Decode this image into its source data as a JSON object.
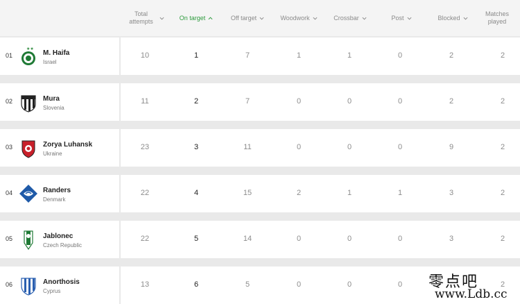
{
  "table": {
    "columns": [
      {
        "label": "Total attempts",
        "sort": "down",
        "active": false
      },
      {
        "label": "On target",
        "sort": "up",
        "active": true
      },
      {
        "label": "Off target",
        "sort": "down",
        "active": false
      },
      {
        "label": "Woodwork",
        "sort": "down",
        "active": false
      },
      {
        "label": "Crossbar",
        "sort": "down",
        "active": false
      },
      {
        "label": "Post",
        "sort": "down",
        "active": false
      },
      {
        "label": "Blocked",
        "sort": "down",
        "active": false
      },
      {
        "label": "Matches played",
        "sort": "none",
        "active": false
      }
    ],
    "rows": [
      {
        "rank": "01",
        "team": "M. Haifa",
        "country": "Israel",
        "crest": "maccabi-haifa-crest-icon",
        "values": [
          "10",
          "1",
          "7",
          "1",
          "1",
          "0",
          "2",
          "2"
        ]
      },
      {
        "rank": "02",
        "team": "Mura",
        "country": "Slovenia",
        "crest": "mura-crest-icon",
        "values": [
          "11",
          "2",
          "7",
          "0",
          "0",
          "0",
          "2",
          "2"
        ]
      },
      {
        "rank": "03",
        "team": "Zorya Luhansk",
        "country": "Ukraine",
        "crest": "zorya-crest-icon",
        "values": [
          "23",
          "3",
          "11",
          "0",
          "0",
          "0",
          "9",
          "2"
        ]
      },
      {
        "rank": "04",
        "team": "Randers",
        "country": "Denmark",
        "crest": "randers-crest-icon",
        "values": [
          "22",
          "4",
          "15",
          "2",
          "1",
          "1",
          "3",
          "2"
        ]
      },
      {
        "rank": "05",
        "team": "Jablonec",
        "country": "Czech Republic",
        "crest": "jablonec-crest-icon",
        "values": [
          "22",
          "5",
          "14",
          "0",
          "0",
          "0",
          "3",
          "2"
        ]
      },
      {
        "rank": "06",
        "team": "Anorthosis",
        "country": "Cyprus",
        "crest": "anorthosis-crest-icon",
        "values": [
          "13",
          "6",
          "5",
          "0",
          "0",
          "0",
          "",
          "2"
        ]
      }
    ]
  },
  "watermark": {
    "chinese": "零点吧",
    "url": "www.Ldb.cc"
  },
  "colors": {
    "accent": "#2e9b3e",
    "background": "#e9e9e9",
    "card": "#ffffff",
    "header_bg": "#f4f4f4"
  }
}
